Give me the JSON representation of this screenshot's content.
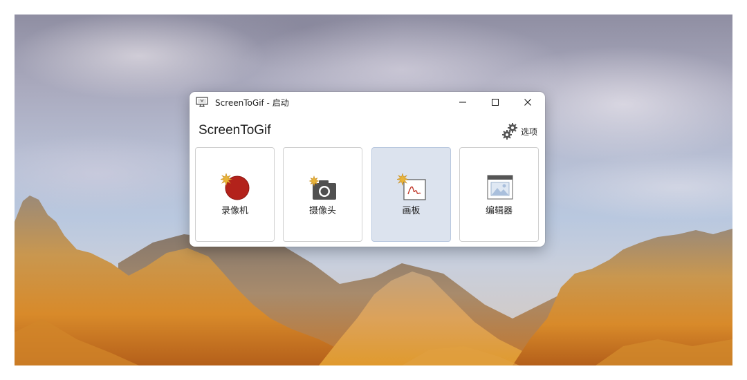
{
  "window": {
    "title": "ScreenToGif - 启动",
    "controls": {
      "minimize": "minimize-icon",
      "maximize": "maximize-icon",
      "close": "close-icon"
    }
  },
  "header": {
    "app_name": "ScreenToGif",
    "options_label": "选项",
    "options_icon": "gears-icon"
  },
  "tiles": [
    {
      "label": "录像机",
      "icon": "recorder-icon",
      "selected": false
    },
    {
      "label": "摄像头",
      "icon": "webcam-icon",
      "selected": false
    },
    {
      "label": "画板",
      "icon": "board-icon",
      "selected": true
    },
    {
      "label": "编辑器",
      "icon": "editor-icon",
      "selected": false
    }
  ],
  "colors": {
    "record_red": "#b3221b",
    "sparkle": "#e8b43a",
    "selected_tile": "#dce3ee",
    "tile_border": "#cfcfcf"
  }
}
